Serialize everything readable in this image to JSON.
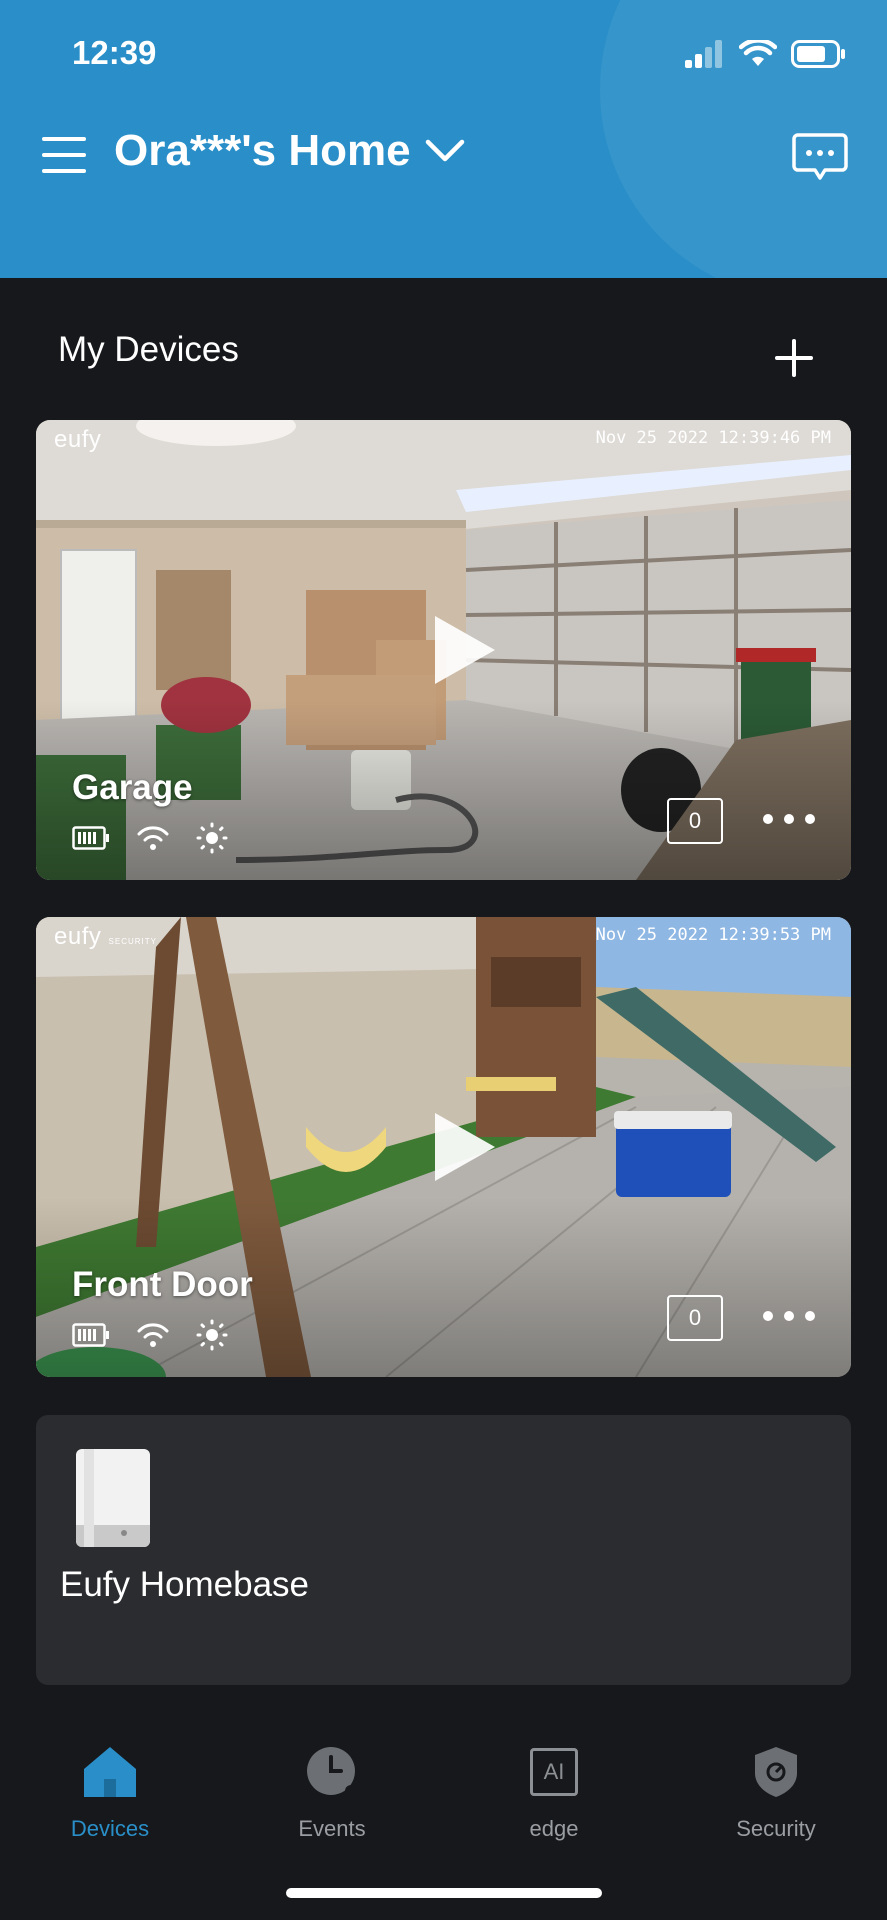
{
  "status_bar": {
    "time": "12:39"
  },
  "header": {
    "title": "Ora***'s Home"
  },
  "devices_section": {
    "title": "My Devices"
  },
  "cameras": [
    {
      "brand": "eufy",
      "timestamp": "Nov 25 2022  12:39:46 PM",
      "name": "Garage",
      "event_count": "0"
    },
    {
      "brand": "eufy",
      "brand_sub": "SECURITY",
      "timestamp": "Nov 25 2022  12:39:53 PM",
      "name": "Front Door",
      "event_count": "0"
    }
  ],
  "homebase": {
    "name": "Eufy Homebase"
  },
  "bottom_nav": [
    {
      "label": "Devices",
      "icon": "home-icon",
      "active": true
    },
    {
      "label": "Events",
      "icon": "clock-icon",
      "active": false
    },
    {
      "label": "edge",
      "icon": "ai-icon",
      "icon_text": "AI",
      "active": false
    },
    {
      "label": "Security",
      "icon": "shield-icon",
      "active": false
    }
  ],
  "colors": {
    "accent": "#2a8fc8",
    "background": "#16181b",
    "card": "#2a2c2f"
  }
}
